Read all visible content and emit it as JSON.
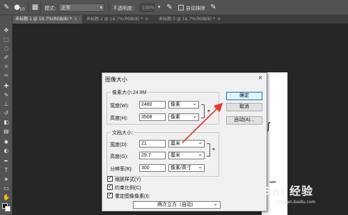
{
  "options_bar": {
    "brush_size": "10",
    "mode_label": "模式:",
    "mode_value": "正常",
    "opacity_label": "不透明度:",
    "opacity_value": "100%",
    "auto_erase_label": "自动抹除"
  },
  "tabs": [
    {
      "label": "未标题-1 @ 16.7%(RGB/8) *",
      "active": true
    },
    {
      "label": "未标题-2 @ 16.7%(RGB/8) *",
      "active": false
    },
    {
      "label": "未标题-3 @ 16.7%(RGB/8) *",
      "active": false
    }
  ],
  "toolbar": {
    "tools": [
      "move-tool-icon",
      "marquee-tool-icon",
      "lasso-tool-icon",
      "quick-select-tool-icon",
      "crop-tool-icon",
      "eyedropper-tool-icon",
      "healing-tool-icon",
      "brush-tool-icon",
      "stamp-tool-icon",
      "history-brush-tool-icon",
      "eraser-tool-icon",
      "gradient-tool-icon",
      "blur-tool-icon",
      "dodge-tool-icon",
      "pen-tool-icon",
      "type-tool-icon",
      "path-select-tool-icon",
      "shape-tool-icon",
      "hand-tool-icon",
      "zoom-tool-icon"
    ]
  },
  "dialog": {
    "title": "图像大小",
    "close": "×",
    "pixel_group": {
      "title": "像素大小:24.9M",
      "width_label": "宽度(W):",
      "width_value": "2480",
      "width_unit": "像素",
      "height_label": "高度(H):",
      "height_value": "3508",
      "height_unit": "像素"
    },
    "doc_group": {
      "title": "文档大小:",
      "width_label": "宽度(D):",
      "width_value": "21",
      "width_unit": "厘米",
      "height_label": "高度(G):",
      "height_value": "29.7",
      "height_unit": "厘米",
      "res_label": "分辨率(R):",
      "res_value": "300",
      "res_unit": "像素/英寸"
    },
    "buttons": {
      "ok": "确定",
      "cancel": "取消",
      "auto": "自动(A)..."
    },
    "checkboxes": {
      "scale_styles": "缩放样式(Y)",
      "constrain": "约束比例(C)",
      "resample": "重定图像像素(I):"
    },
    "resample_method": "两次立方（自动）"
  },
  "watermark": {
    "brand": "Bai 经验",
    "sub": "jingyan.baidu.com"
  },
  "colors": {
    "annotation_arrow": "#e8322f",
    "app_bg": "#262626",
    "panel_bg": "#535353"
  }
}
